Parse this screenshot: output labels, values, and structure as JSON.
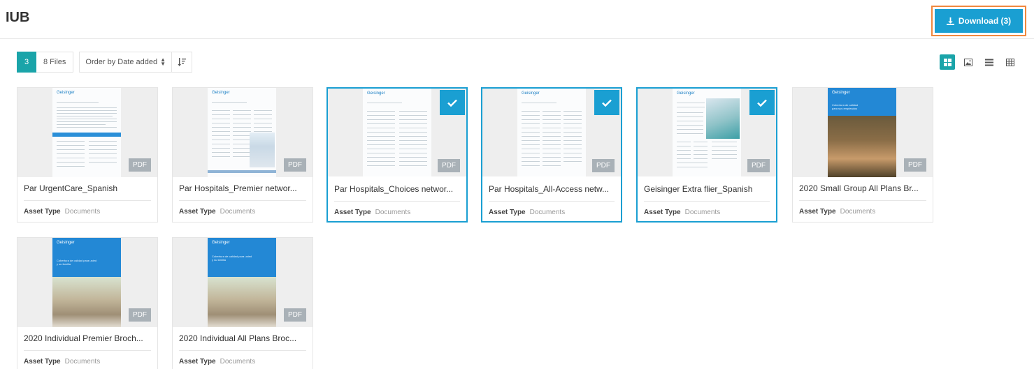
{
  "header": {
    "title": "IUB",
    "download_label": "Download (3)"
  },
  "toolbar": {
    "selected_count": "3",
    "files_label": "8 Files",
    "order_label": "Order by Date added"
  },
  "views": [
    "grid-view-icon",
    "image-view-icon",
    "list-view-icon",
    "table-view-icon"
  ],
  "colors": {
    "accent": "#1a9fd2",
    "teal": "#1aa4a9",
    "highlight": "#f0883e",
    "pdf_badge": "#a9b1b7"
  },
  "assets": [
    {
      "name": "Par UrgentCare_Spanish",
      "asset_type_label": "Asset Type",
      "asset_type": "Documents",
      "badge": "PDF",
      "selected": false,
      "thumb_logo": "Geisinger"
    },
    {
      "name": "Par Hospitals_Premier networ...",
      "asset_type_label": "Asset Type",
      "asset_type": "Documents",
      "badge": "PDF",
      "selected": false,
      "thumb_logo": "Geisinger"
    },
    {
      "name": "Par Hospitals_Choices networ...",
      "asset_type_label": "Asset Type",
      "asset_type": "Documents",
      "badge": "PDF",
      "selected": true,
      "thumb_logo": "Geisinger"
    },
    {
      "name": "Par Hospitals_All-Access netw...",
      "asset_type_label": "Asset Type",
      "asset_type": "Documents",
      "badge": "PDF",
      "selected": true,
      "thumb_logo": "Geisinger"
    },
    {
      "name": "Geisinger Extra flier_Spanish",
      "asset_type_label": "Asset Type",
      "asset_type": "Documents",
      "badge": "PDF",
      "selected": true,
      "thumb_logo": "Geisinger"
    },
    {
      "name": "2020 Small Group All Plans Br...",
      "asset_type_label": "Asset Type",
      "asset_type": "Documents",
      "badge": "PDF",
      "selected": false,
      "thumb_logo": "Geisinger",
      "thumb_cover_text": "Cobertura de calidad para sus empleados"
    },
    {
      "name": "2020 Individual Premier Broch...",
      "asset_type_label": "Asset Type",
      "asset_type": "Documents",
      "badge": "PDF",
      "selected": false,
      "thumb_logo": "Geisinger",
      "thumb_cover_text": "Cobertura de calidad para usted y su familia"
    },
    {
      "name": "2020 Individual All Plans Broc...",
      "asset_type_label": "Asset Type",
      "asset_type": "Documents",
      "badge": "PDF",
      "selected": false,
      "thumb_logo": "Geisinger",
      "thumb_cover_text": "Cobertura de calidad para usted y su familia"
    }
  ]
}
